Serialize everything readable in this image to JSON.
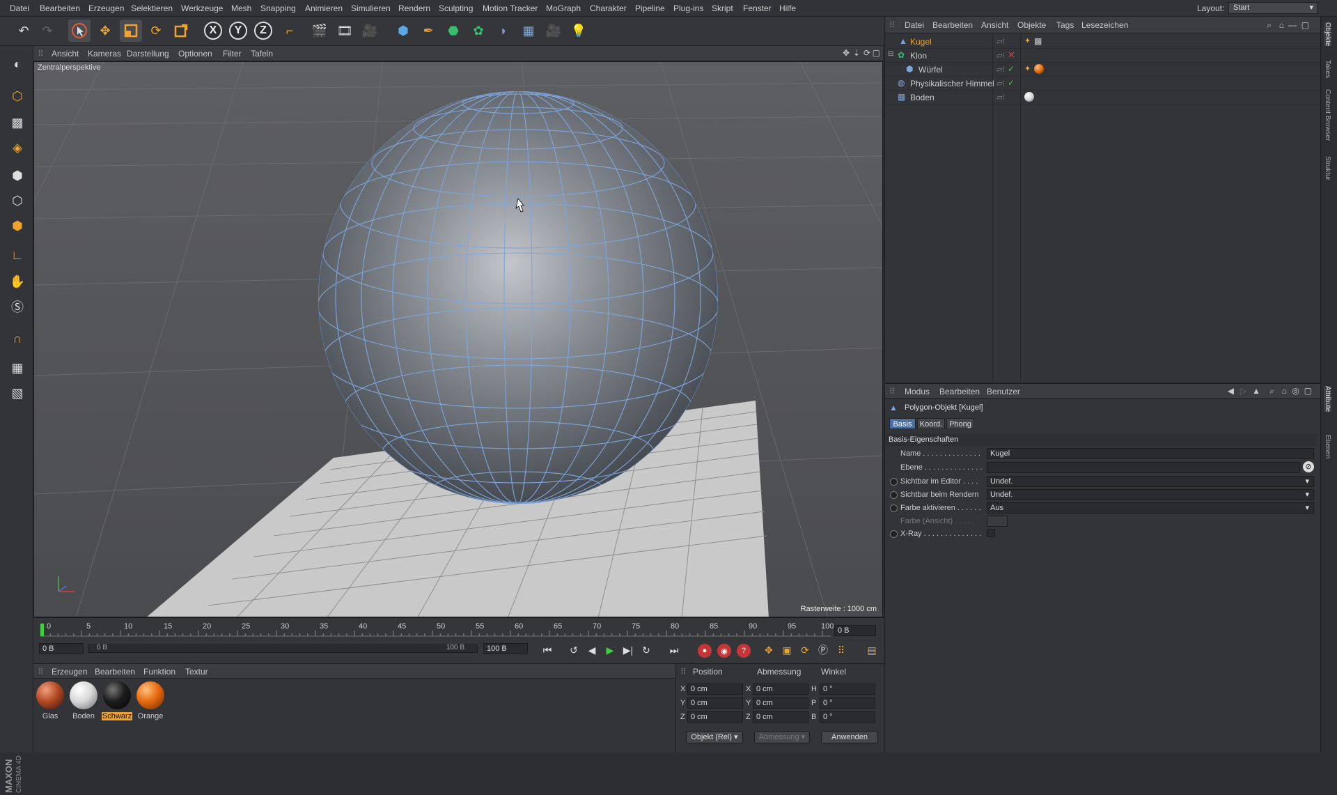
{
  "menu": [
    "Datei",
    "Bearbeiten",
    "Erzeugen",
    "Selektieren",
    "Werkzeuge",
    "Mesh",
    "Snapping",
    "Animieren",
    "Simulieren",
    "Rendern",
    "Sculpting",
    "Motion Tracker",
    "MoGraph",
    "Charakter",
    "Pipeline",
    "Plug-ins",
    "Skript",
    "Fenster",
    "Hilfe"
  ],
  "layout": {
    "label": "Layout:",
    "value": "Start"
  },
  "toolbar": {
    "axis_x": "X",
    "axis_y": "Y",
    "axis_z": "Z"
  },
  "viewport": {
    "menu": [
      "Ansicht",
      "Kameras",
      "Darstellung",
      "Optionen",
      "Filter",
      "Tafeln"
    ],
    "label": "Zentralperspektive",
    "raster": "Rasterweite : 1000 cm"
  },
  "timeline": {
    "ticks": [
      "0",
      "5",
      "10",
      "15",
      "20",
      "25",
      "30",
      "35",
      "40",
      "45",
      "50",
      "55",
      "60",
      "65",
      "70",
      "75",
      "80",
      "85",
      "90",
      "95",
      "100"
    ],
    "frame_display": "0 B",
    "start": "0 B",
    "range_start": "0 B",
    "range_end": "100 B",
    "end": "100 B"
  },
  "materials": {
    "menu": [
      "Erzeugen",
      "Bearbeiten",
      "Funktion",
      "Textur"
    ],
    "items": [
      {
        "name": "Glas",
        "color": "#b34a25"
      },
      {
        "name": "Boden",
        "color": "#e8e8e8"
      },
      {
        "name": "Schwarz",
        "color": "#1c1c1c"
      },
      {
        "name": "Orange",
        "color": "#e66a10"
      }
    ],
    "selected_index": 2
  },
  "coords": {
    "headers": [
      "Position",
      "Abmessung",
      "Winkel"
    ],
    "rows": [
      {
        "axis": "X",
        "pos": "0 cm",
        "dim_axis": "X",
        "dim": "0 cm",
        "rot_axis": "H",
        "rot": "0 °"
      },
      {
        "axis": "Y",
        "pos": "0 cm",
        "dim_axis": "Y",
        "dim": "0 cm",
        "rot_axis": "P",
        "rot": "0 °"
      },
      {
        "axis": "Z",
        "pos": "0 cm",
        "dim_axis": "Z",
        "dim": "0 cm",
        "rot_axis": "B",
        "rot": "0 °"
      }
    ],
    "mode_select": "Objekt (Rel)",
    "size_select": "Abmessung",
    "apply_button": "Anwenden"
  },
  "object_manager": {
    "menu": [
      "Datei",
      "Bearbeiten",
      "Ansicht",
      "Objekte",
      "Tags",
      "Lesezeichen"
    ],
    "objects": [
      {
        "name": "Kugel",
        "indent": 0,
        "selected": true
      },
      {
        "name": "Klon",
        "indent": 0,
        "selected": false
      },
      {
        "name": "Würfel",
        "indent": 1,
        "selected": false
      },
      {
        "name": "Physikalischer Himmel",
        "indent": 0,
        "selected": false
      },
      {
        "name": "Boden",
        "indent": 0,
        "selected": false
      }
    ]
  },
  "attributes": {
    "menu": [
      "Modus",
      "Bearbeiten",
      "Benutzer"
    ],
    "title": "Polygon-Objekt [Kugel]",
    "tabs": [
      "Basis",
      "Koord.",
      "Phong"
    ],
    "section": "Basis-Eigenschaften",
    "fields": {
      "name_label": "Name . . . . . . . . . . . . . .",
      "name_value": "Kugel",
      "layer_label": "Ebene . . . . . . . . . . . . . .",
      "vis_editor_label": "Sichtbar im Editor . . . .",
      "vis_editor_value": "Undef.",
      "vis_render_label": "Sichtbar beim Rendern",
      "vis_render_value": "Undef.",
      "color_enable_label": "Farbe aktivieren . . . . . .",
      "color_enable_value": "Aus",
      "color_view_label": "Farbe (Ansicht) . . . . .",
      "xray_label": "X-Ray . . . . . . . . . . . . . ."
    }
  },
  "side_tabs": [
    "Objekte",
    "Takes",
    "Content Browser",
    "Struktur",
    "Attribute",
    "Ebenen"
  ],
  "brand": "MAXON CINEMA 4D"
}
